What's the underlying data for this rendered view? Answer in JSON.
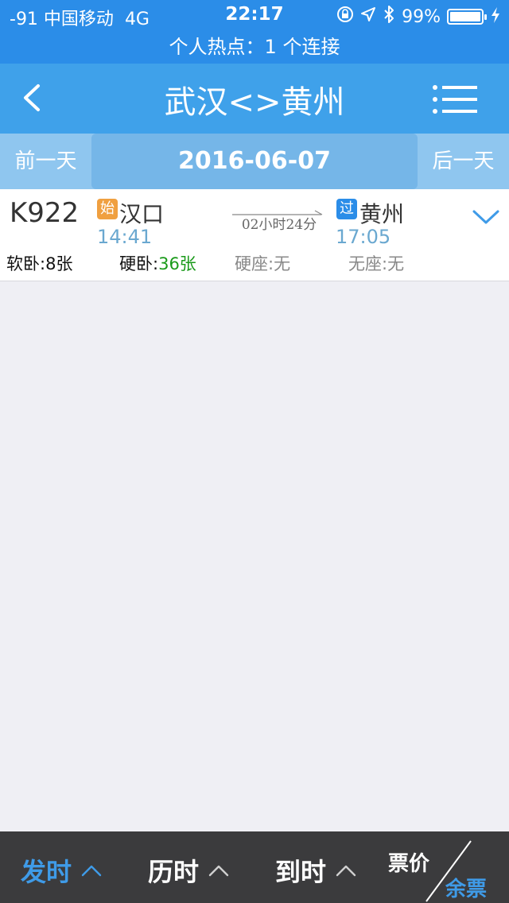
{
  "status_bar": {
    "signal_carrier": "-91 中国移动",
    "network": "4G",
    "time": "22:17",
    "battery": "99%"
  },
  "hotspot": {
    "text": "个人热点：1 个连接"
  },
  "nav": {
    "title": "武汉<>黄州",
    "back_icon": "chevron-left-icon",
    "menu_icon": "menu-icon"
  },
  "date_bar": {
    "prev_label": "前一天",
    "date": "2016-06-07",
    "next_label": "后一天"
  },
  "trains": [
    {
      "train_no": "K922",
      "from_badge": "始",
      "from_station": "汉口",
      "depart_time": "14:41",
      "duration": "02小时24分",
      "to_badge": "过",
      "to_station": "黄州",
      "arrive_time": "17:05",
      "seats": [
        {
          "label": "软卧:",
          "count": "8张"
        },
        {
          "label": "硬卧:",
          "count": "36张"
        },
        {
          "label": "硬座:",
          "count": "无"
        },
        {
          "label": "无座:",
          "count": "无"
        }
      ]
    }
  ],
  "bottom_bar": {
    "depart_sort": "发时",
    "duration_sort": "历时",
    "arrive_sort": "到时",
    "price": "票价",
    "remaining": "余票",
    "active_color": "#3f9be8"
  }
}
